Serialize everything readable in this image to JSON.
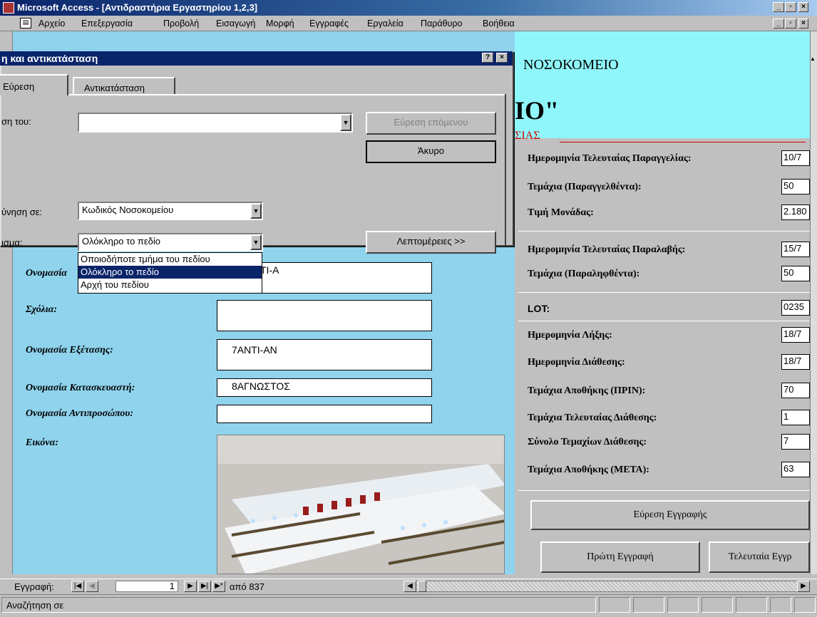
{
  "window": {
    "title": "Microsoft Access - [Αντιδραστήρια Εργαστηρίου 1,2,3]",
    "minimize": "_",
    "maximize": "▫",
    "close": "×"
  },
  "menu": [
    "Αρχείο",
    "Επεξεργασία",
    "Προβολή",
    "Εισαγωγή",
    "Μορφή",
    "Εγγραφές",
    "Εργαλεία",
    "Παράθυρο",
    "Βοήθεια"
  ],
  "header": {
    "line1": "ΝΟΣΟΚΟΜΕΙΟ",
    "line2": "ΙΟ\"",
    "line3": "ΣΙΑΣ"
  },
  "dialog": {
    "title": "η και αντικατάσταση",
    "help": "?",
    "close": "×",
    "tabs": [
      "Εύρεση",
      "Αντικατάσταση"
    ],
    "find_label": "ση του:",
    "find_value": "",
    "find_next": "Εύρεση επόμενου",
    "cancel": "Άκυρο",
    "look_in_label": "ύνηση σε:",
    "look_in_value": "Κωδικός Νοσοκομείου",
    "match_label": "ισμα:",
    "match_value": "Ολόκληρο το πεδίο",
    "more": "Λεπτομέρειες >>",
    "options": [
      "Οποιοδήποτε τμήμα του πεδίου",
      "Ολόκληρο το πεδίο",
      "Αρχή του πεδίου"
    ]
  },
  "left_fields": {
    "name_label": "Ονομασία",
    "name_value": "ΤΙ-Α",
    "comments_label": "Σχόλια:",
    "comments_value": "",
    "exam_label": "Ονομασία Εξέτασης:",
    "exam_value": "7ΑΝΤΙ-ΑΝ",
    "manuf_label": "Ονομασία Κατασκευαστή:",
    "manuf_value": "8ΑΓΝΩΣΤΟΣ",
    "rep_label": "Ονομασία Αντιπροσώπου:",
    "rep_value": "",
    "image_label": "Εικόνα:"
  },
  "right_fields": [
    {
      "label": "Ημερομηνία Τελευταίας Παραγγελίας:",
      "value": "10/7"
    },
    {
      "label": "Τεμάχια (Παραγγελθέντα):",
      "value": "50"
    },
    {
      "label": "Τιμή Μονάδας:",
      "value": "2.180"
    },
    {
      "label": "Ημερομηνία Τελευταίας Παραλαβής:",
      "value": "15/7"
    },
    {
      "label": "Τεμάχια (Παραληφθέντα):",
      "value": "50"
    },
    {
      "label": "LOT:",
      "value": "0235"
    },
    {
      "label": "Ημερομηνία Λήξης:",
      "value": "18/7"
    },
    {
      "label": "Ημερομηνία Διάθεσης:",
      "value": "18/7"
    },
    {
      "label": "Τεμάχια Αποθήκης (ΠΡΙΝ):",
      "value": "70"
    },
    {
      "label": "Τεμάχια Τελευταίας Διάθεσης:",
      "value": "1"
    },
    {
      "label": "Σύνολο Τεμαχίων Διάθεσης:",
      "value": "7"
    },
    {
      "label": "Τεμάχια Αποθήκης (ΜΕΤΑ):",
      "value": "63"
    }
  ],
  "buttons": {
    "find_record": "Εύρεση Εγγραφής",
    "first_record": "Πρώτη Εγγραφή",
    "last_record": "Τελευταία Εγγρ"
  },
  "recnav": {
    "label": "Εγγραφή:",
    "current": "1",
    "of_total": "από 837"
  },
  "status": {
    "text": "Αναζήτηση σε"
  }
}
